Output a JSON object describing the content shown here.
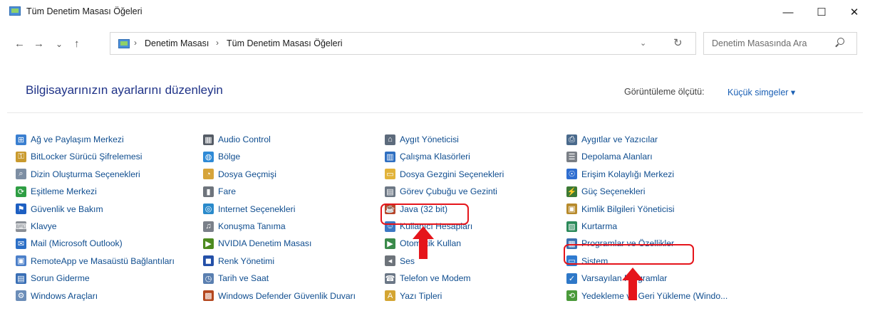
{
  "window": {
    "title": "Tüm Denetim Masası Öğeleri",
    "min_label": "—",
    "max_label": "☐",
    "close_label": "✕"
  },
  "nav": {
    "back": "←",
    "forward": "→",
    "recent": "⌄",
    "up": "↑",
    "sep": "›",
    "dropdown": "⌄",
    "refresh": "↻"
  },
  "breadcrumb": {
    "items": [
      "Denetim Masası",
      "Tüm Denetim Masası Öğeleri"
    ]
  },
  "search": {
    "placeholder": "Denetim Masasında Ara"
  },
  "header": {
    "title": "Bilgisayarınızın ayarlarını düzenleyin",
    "view_by_label": "Görüntüleme ölçütü:",
    "view_by_value": "Küçük simgeler ▾"
  },
  "columns": [
    [
      {
        "label": "Ağ ve Paylaşım Merkezi",
        "icon": "network-icon",
        "color": "#3a7fd0",
        "glyph": "⊞"
      },
      {
        "label": "BitLocker Sürücü Şifrelemesi",
        "icon": "bitlocker-icon",
        "color": "#c99a2e",
        "glyph": "⚿"
      },
      {
        "label": "Dizin Oluşturma Seçenekleri",
        "icon": "indexing-icon",
        "color": "#7d8ea3",
        "glyph": "⌕"
      },
      {
        "label": "Eşitleme Merkezi",
        "icon": "sync-icon",
        "color": "#2e9e43",
        "glyph": "⟳"
      },
      {
        "label": "Güvenlik ve Bakım",
        "icon": "flag-icon",
        "color": "#1d5fc2",
        "glyph": "⚑"
      },
      {
        "label": "Klavye",
        "icon": "keyboard-icon",
        "color": "#8a8f96",
        "glyph": "⌨"
      },
      {
        "label": "Mail (Microsoft Outlook)",
        "icon": "mail-icon",
        "color": "#2c6fc6",
        "glyph": "✉"
      },
      {
        "label": "RemoteApp ve Masaüstü Bağlantıları",
        "icon": "remoteapp-icon",
        "color": "#4b7fc9",
        "glyph": "▣"
      },
      {
        "label": "Sorun Giderme",
        "icon": "troubleshoot-icon",
        "color": "#3a6fb5",
        "glyph": "▤"
      },
      {
        "label": "Windows Araçları",
        "icon": "tools-icon",
        "color": "#6b8db8",
        "glyph": "⚙"
      }
    ],
    [
      {
        "label": "Audio Control",
        "icon": "audio-icon",
        "color": "#555c66",
        "glyph": "▦"
      },
      {
        "label": "Bölge",
        "icon": "globe-icon",
        "color": "#2f8ad6",
        "glyph": "◍"
      },
      {
        "label": "Dosya Geçmişi",
        "icon": "file-history-icon",
        "color": "#d6a43a",
        "glyph": "◔"
      },
      {
        "label": "Fare",
        "icon": "mouse-icon",
        "color": "#6e747c",
        "glyph": "▮"
      },
      {
        "label": "Internet Seçenekleri",
        "icon": "internet-icon",
        "color": "#2a8acb",
        "glyph": "◎"
      },
      {
        "label": "Konuşma Tanıma",
        "icon": "microphone-icon",
        "color": "#7a8089",
        "glyph": "♫"
      },
      {
        "label": "NVIDIA Denetim Masası",
        "icon": "nvidia-icon",
        "color": "#4c8a1f",
        "glyph": "▶"
      },
      {
        "label": "Renk Yönetimi",
        "icon": "color-icon",
        "color": "#2450a8",
        "glyph": "◼"
      },
      {
        "label": "Tarih ve Saat",
        "icon": "clock-icon",
        "color": "#5a7fb0",
        "glyph": "◷"
      },
      {
        "label": "Windows Defender Güvenlik Duvarı",
        "icon": "firewall-icon",
        "color": "#b4471f",
        "glyph": "▩"
      }
    ],
    [
      {
        "label": "Aygıt Yöneticisi",
        "icon": "device-manager-icon",
        "color": "#5d6b7c",
        "glyph": "⌂"
      },
      {
        "label": "Çalışma Klasörleri",
        "icon": "work-folders-icon",
        "color": "#2f6fc1",
        "glyph": "▥"
      },
      {
        "label": "Dosya Gezgini Seçenekleri",
        "icon": "folder-options-icon",
        "color": "#e2b33a",
        "glyph": "▭"
      },
      {
        "label": "Görev Çubuğu ve Gezinti",
        "icon": "taskbar-icon",
        "color": "#6c7784",
        "glyph": "▤"
      },
      {
        "label": "Java (32 bit)",
        "icon": "java-icon",
        "color": "#b7452a",
        "glyph": "☕"
      },
      {
        "label": "Kullanıcı Hesapları",
        "icon": "users-icon",
        "color": "#3c78c4",
        "glyph": "☺"
      },
      {
        "label": "Otomatik Kullan",
        "icon": "autoplay-icon",
        "color": "#3a8a4a",
        "glyph": "▶"
      },
      {
        "label": "Ses",
        "icon": "speaker-icon",
        "color": "#6d737a",
        "glyph": "◂"
      },
      {
        "label": "Telefon ve Modem",
        "icon": "phone-icon",
        "color": "#6b7786",
        "glyph": "☎"
      },
      {
        "label": "Yazı Tipleri",
        "icon": "fonts-icon",
        "color": "#d4a532",
        "glyph": "A"
      }
    ],
    [
      {
        "label": "Aygıtlar ve Yazıcılar",
        "icon": "printer-icon",
        "color": "#4a6a8c",
        "glyph": "⎙"
      },
      {
        "label": "Depolama Alanları",
        "icon": "storage-icon",
        "color": "#7a7f86",
        "glyph": "☰"
      },
      {
        "label": "Erişim Kolaylığı Merkezi",
        "icon": "accessibility-icon",
        "color": "#2f6ed0",
        "glyph": "☉"
      },
      {
        "label": "Güç Seçenekleri",
        "icon": "power-icon",
        "color": "#3c7a34",
        "glyph": "⚡"
      },
      {
        "label": "Kimlik Bilgileri Yöneticisi",
        "icon": "credentials-icon",
        "color": "#b78a2b",
        "glyph": "▣"
      },
      {
        "label": "Kurtarma",
        "icon": "recovery-icon",
        "color": "#2c8a5a",
        "glyph": "▧"
      },
      {
        "label": "Programlar ve Özellikler",
        "icon": "programs-icon",
        "color": "#3c6fb0",
        "glyph": "▦"
      },
      {
        "label": "Sistem",
        "icon": "system-icon",
        "color": "#2f7bd0",
        "glyph": "▭"
      },
      {
        "label": "Varsayılan Programlar",
        "icon": "default-programs-icon",
        "color": "#2e78c8",
        "glyph": "✓"
      },
      {
        "label": "Yedekleme ve Geri Yükleme (Windo...",
        "icon": "backup-icon",
        "color": "#4a9a3a",
        "glyph": "⟲"
      }
    ]
  ],
  "highlights": {
    "color": "#e5151b"
  }
}
